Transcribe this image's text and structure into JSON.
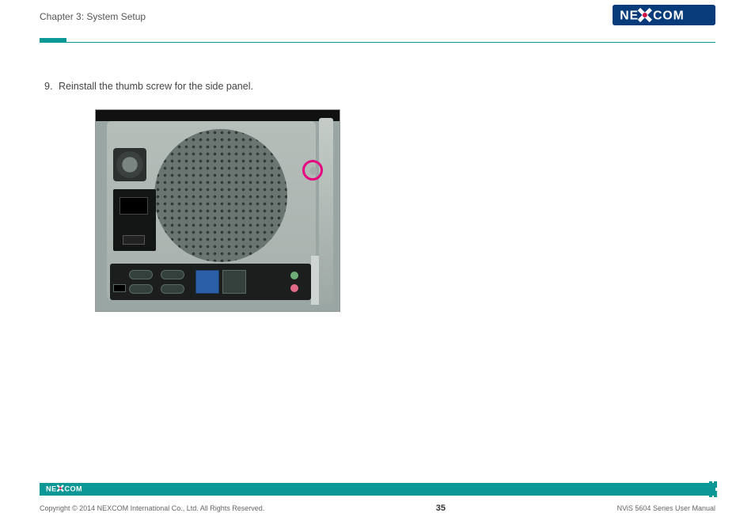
{
  "header": {
    "chapter_title": "Chapter 3: System Setup",
    "brand": "NEXCOM"
  },
  "content": {
    "step": {
      "number": "9.",
      "text": "Reinstall the thumb screw for the side panel."
    }
  },
  "footer": {
    "copyright": "Copyright © 2014 NEXCOM International Co., Ltd. All Rights Reserved.",
    "page_number": "35",
    "doc_title": "NViS 5604 Series User Manual",
    "brand_small": "NEXCOM"
  },
  "colors": {
    "accent": "#0a9796",
    "highlight": "#e4007f"
  }
}
